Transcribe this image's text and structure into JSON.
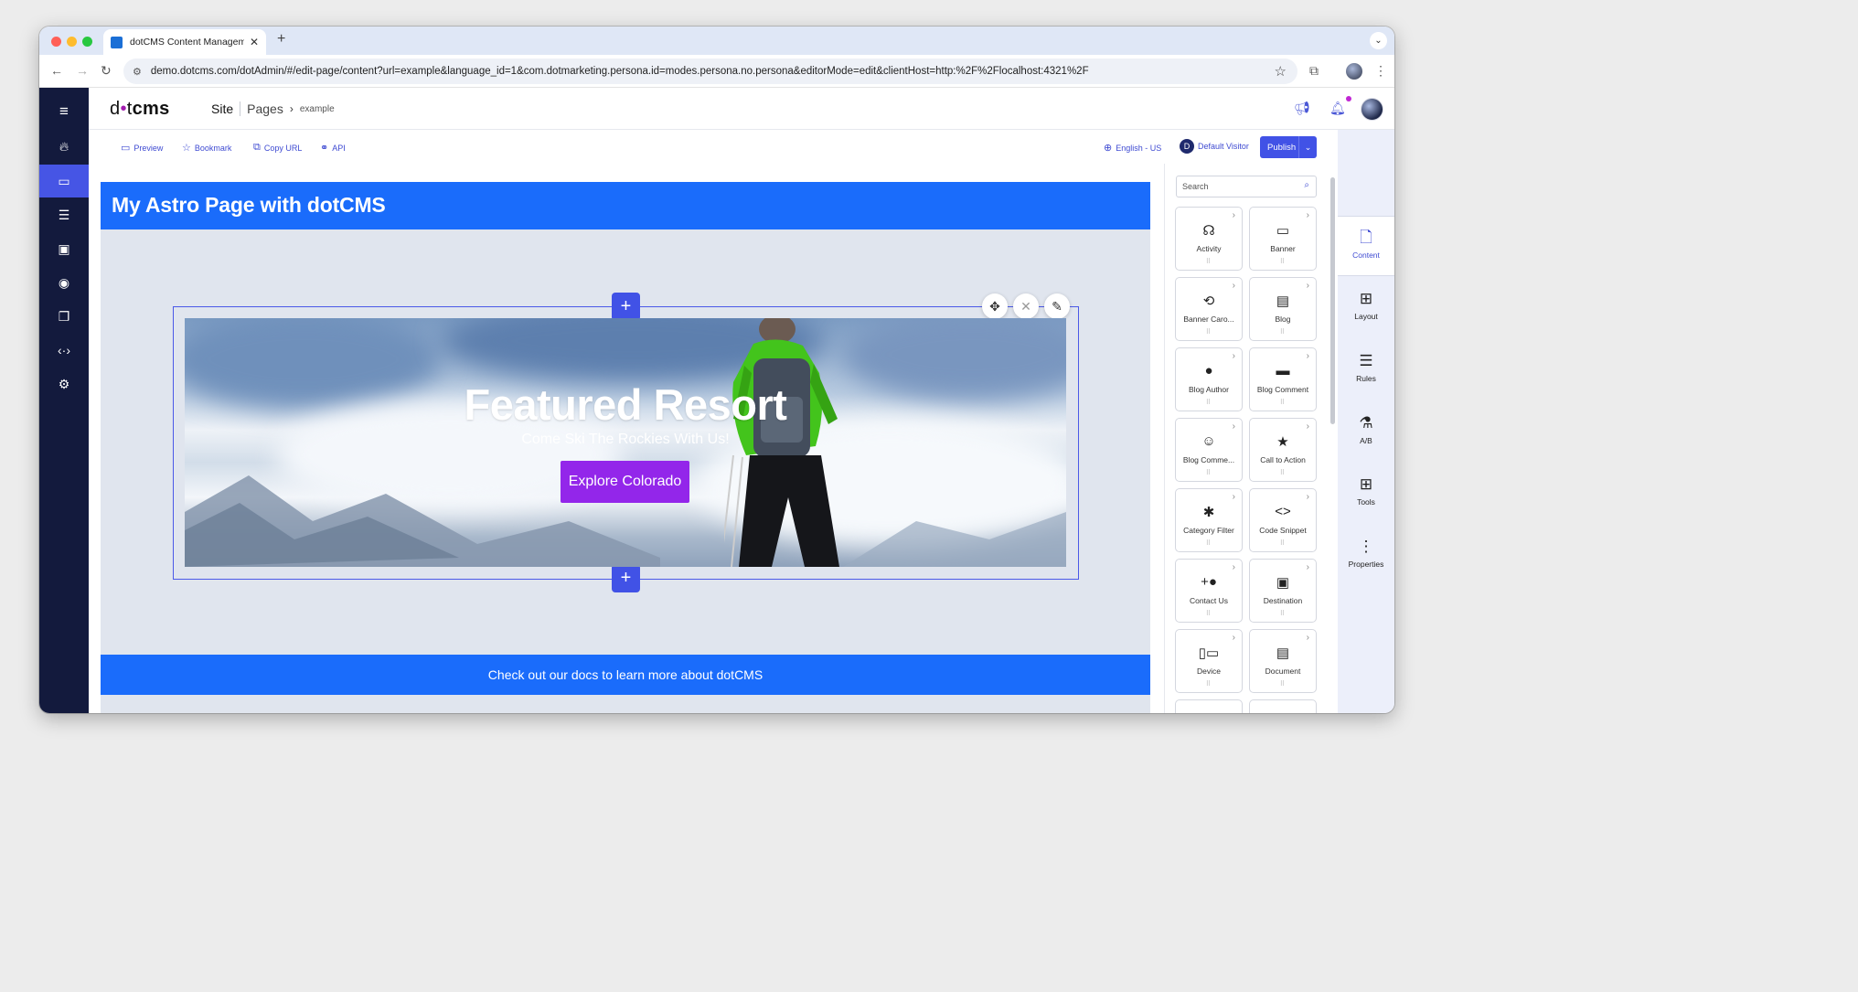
{
  "browser": {
    "tab_title": "dotCMS Content Managemen",
    "url": "demo.dotcms.com/dotAdmin/#/edit-page/content?url=example&language_id=1&com.dotmarketing.persona.id=modes.persona.no.persona&editorMode=edit&clientHost=http:%2F%2Flocalhost:4321%2F"
  },
  "header": {
    "logo_pre": "d",
    "logo_dot": "•",
    "logo_mid": "t",
    "logo_bold": "cms",
    "breadcrumb_site": "Site",
    "breadcrumb_pages": "Pages",
    "breadcrumb_leaf": "example"
  },
  "toolbar": {
    "preview": "Preview",
    "bookmark": "Bookmark",
    "copy_url": "Copy URL",
    "api": "API",
    "language": "English - US",
    "visitor_initial": "D",
    "visitor": "Default Visitor",
    "publish": "Publish"
  },
  "page": {
    "title": "My Astro Page with dotCMS",
    "hero_title": "Featured Resort",
    "hero_subtitle": "Come Ski The Rockies With Us!",
    "hero_button": "Explore Colorado",
    "footer_text": "Check out our docs to learn more about dotCMS"
  },
  "palette": {
    "search_placeholder": "Search",
    "items": [
      {
        "label": "Activity",
        "icon": "activity-icon",
        "glyph": "☊"
      },
      {
        "label": "Banner",
        "icon": "banner-icon",
        "glyph": "▭"
      },
      {
        "label": "Banner Caro...",
        "icon": "carousel-icon",
        "glyph": "⟲"
      },
      {
        "label": "Blog",
        "icon": "blog-icon",
        "glyph": "▤"
      },
      {
        "label": "Blog Author",
        "icon": "person-icon",
        "glyph": "●"
      },
      {
        "label": "Blog Comment",
        "icon": "comment-icon",
        "glyph": "▬"
      },
      {
        "label": "Blog Comme...",
        "icon": "smiley-icon",
        "glyph": "☺"
      },
      {
        "label": "Call to Action",
        "icon": "star-icon",
        "glyph": "★"
      },
      {
        "label": "Category Filter",
        "icon": "puzzle-icon",
        "glyph": "✱"
      },
      {
        "label": "Code Snippet",
        "icon": "code-icon",
        "glyph": "<>"
      },
      {
        "label": "Contact Us",
        "icon": "add-person-icon",
        "glyph": "+●"
      },
      {
        "label": "Destination",
        "icon": "destination-icon",
        "glyph": "▣"
      },
      {
        "label": "Device",
        "icon": "device-icon",
        "glyph": "▯▭"
      },
      {
        "label": "Document",
        "icon": "document-icon",
        "glyph": "▤"
      }
    ]
  },
  "right_sidebar": {
    "items": [
      {
        "label": "Content",
        "icon": "content-icon",
        "glyph": "🗋"
      },
      {
        "label": "Layout",
        "icon": "layout-icon",
        "glyph": "⊞"
      },
      {
        "label": "Rules",
        "icon": "rules-icon",
        "glyph": "☰"
      },
      {
        "label": "A/B",
        "icon": "flask-icon",
        "glyph": "⚗"
      },
      {
        "label": "Tools",
        "icon": "tools-icon",
        "glyph": "⊞"
      },
      {
        "label": "Properties",
        "icon": "more-vert-icon",
        "glyph": "⋮"
      }
    ]
  },
  "colors": {
    "accent": "#4152e6",
    "page_blue": "#1a6cfb",
    "cta_purple": "#9326ea",
    "nav_dark": "#131a3d"
  }
}
